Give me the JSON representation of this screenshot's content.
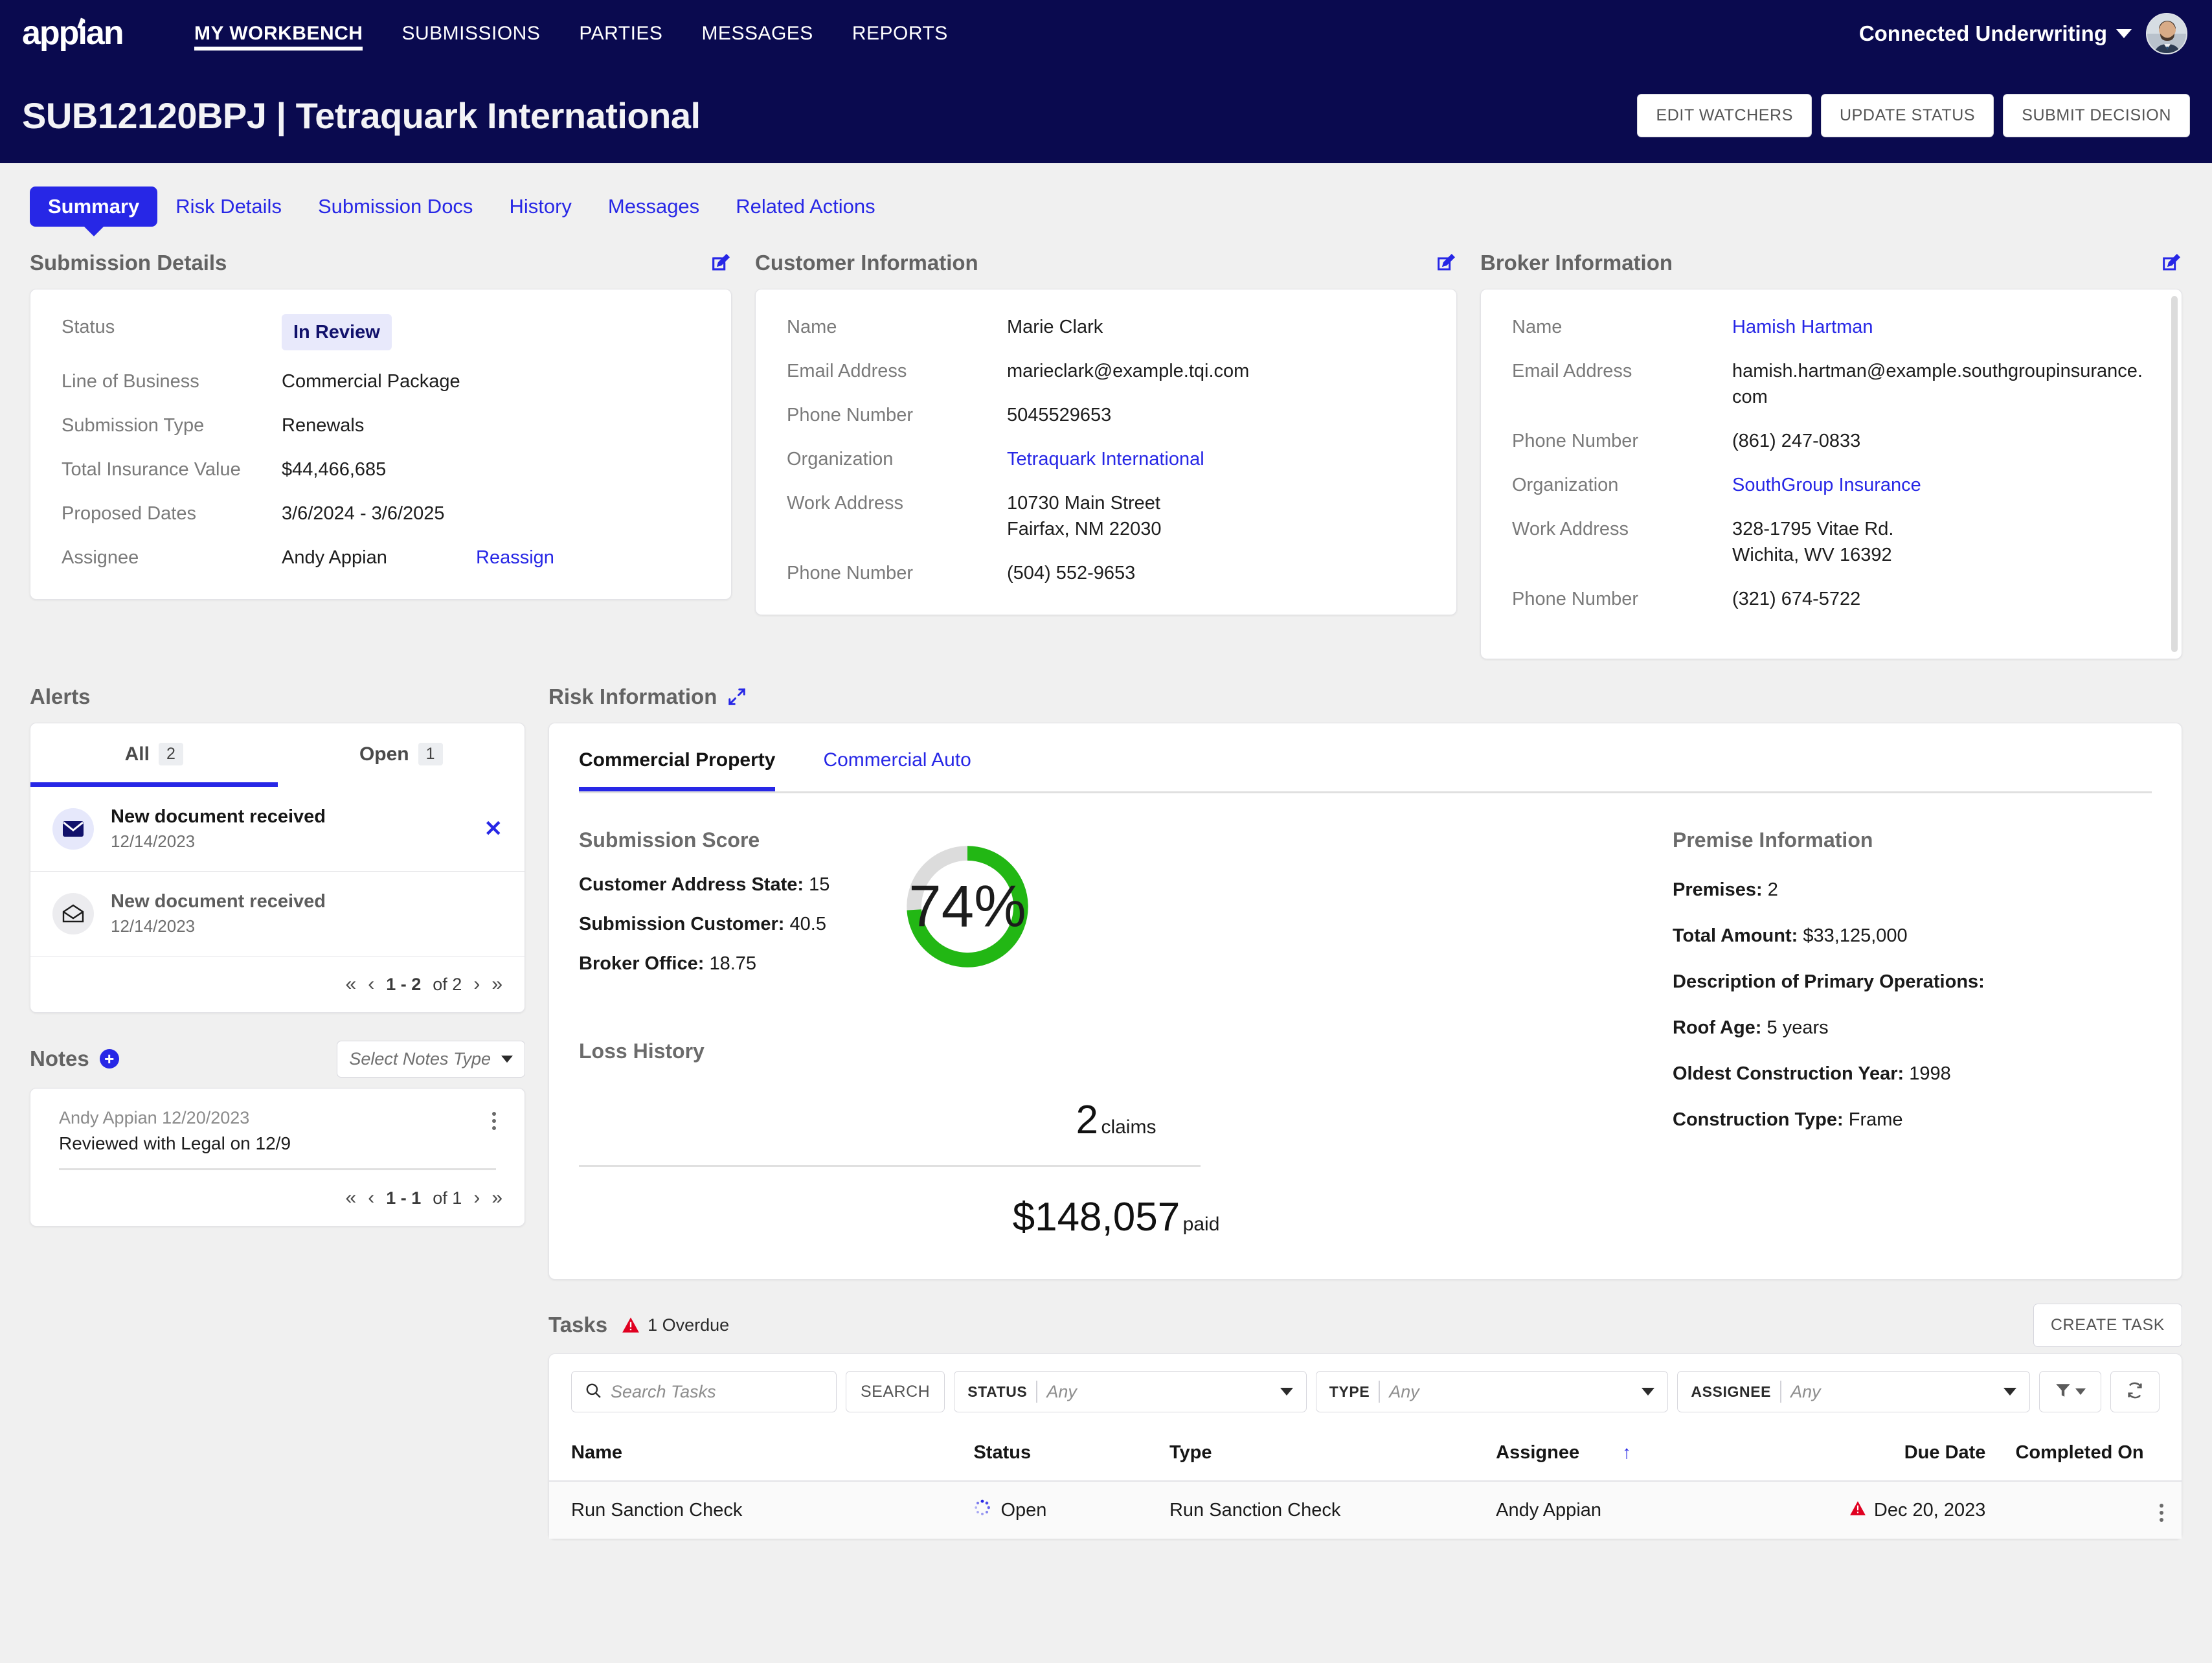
{
  "topnav": {
    "logo_alt": "appian",
    "items": [
      {
        "label": "MY WORKBENCH",
        "active": true
      },
      {
        "label": "SUBMISSIONS",
        "active": false
      },
      {
        "label": "PARTIES",
        "active": false
      },
      {
        "label": "MESSAGES",
        "active": false
      },
      {
        "label": "REPORTS",
        "active": false
      }
    ],
    "tenant": "Connected Underwriting"
  },
  "header": {
    "title": "SUB12120BPJ | Tetraquark International",
    "actions": [
      "EDIT WATCHERS",
      "UPDATE STATUS",
      "SUBMIT DECISION"
    ]
  },
  "tabs": [
    {
      "label": "Summary",
      "active": true
    },
    {
      "label": "Risk Details",
      "active": false
    },
    {
      "label": "Submission Docs",
      "active": false
    },
    {
      "label": "History",
      "active": false
    },
    {
      "label": "Messages",
      "active": false
    },
    {
      "label": "Related Actions",
      "active": false
    }
  ],
  "submission_details": {
    "title": "Submission Details",
    "status_label": "Status",
    "status_value": "In Review",
    "rows": [
      {
        "k": "Line of Business",
        "v": "Commercial Package"
      },
      {
        "k": "Submission Type",
        "v": "Renewals"
      },
      {
        "k": "Total Insurance Value",
        "v": "$44,466,685"
      },
      {
        "k": "Proposed Dates",
        "v": "3/6/2024 - 3/6/2025"
      }
    ],
    "assignee_label": "Assignee",
    "assignee_value": "Andy Appian",
    "reassign_label": "Reassign"
  },
  "customer_information": {
    "title": "Customer Information",
    "rows": [
      {
        "k": "Name",
        "v": "Marie Clark",
        "link": false
      },
      {
        "k": "Email Address",
        "v": "marieclark@example.tqi.com",
        "link": false
      },
      {
        "k": "Phone Number",
        "v": "5045529653",
        "link": false
      },
      {
        "k": "Organization",
        "v": "Tetraquark International",
        "link": true
      }
    ],
    "work_address_label": "Work Address",
    "work_address_line1": "10730 Main Street",
    "work_address_line2": "Fairfax, NM 22030",
    "phone_label": "Phone Number",
    "phone_value": "(504) 552-9653"
  },
  "broker_information": {
    "title": "Broker Information",
    "name_label": "Name",
    "name_value": "Hamish Hartman",
    "email_label": "Email Address",
    "email_value": "hamish.hartman@example.southgroupinsurance.com",
    "phone1_label": "Phone Number",
    "phone1_value": "(861) 247-0833",
    "org_label": "Organization",
    "org_value": "SouthGroup Insurance",
    "work_address_label": "Work Address",
    "work_address_line1": "328-1795 Vitae Rd.",
    "work_address_line2": "Wichita, WV 16392",
    "phone2_label": "Phone Number",
    "phone2_value": "(321) 674-5722"
  },
  "alerts": {
    "title": "Alerts",
    "tabs": [
      {
        "label": "All",
        "count": "2",
        "active": true
      },
      {
        "label": "Open",
        "count": "1",
        "active": false
      }
    ],
    "items": [
      {
        "title": "New document received",
        "date": "12/14/2023",
        "unread": true,
        "icon": "envelope-filled-icon"
      },
      {
        "title": "New document received",
        "date": "12/14/2023",
        "unread": false,
        "icon": "envelope-open-icon"
      }
    ],
    "pager": {
      "first": "«",
      "prev": "‹",
      "range": "1 - 2",
      "of": "of 2",
      "next": "›",
      "last": "»"
    }
  },
  "notes": {
    "title": "Notes",
    "select_placeholder": "Select Notes Type",
    "items": [
      {
        "author": "Andy Appian",
        "date": "12/20/2023",
        "text": "Reviewed with Legal on 12/9"
      }
    ],
    "pager": {
      "first": "«",
      "prev": "‹",
      "range": "1 - 1",
      "of": "of 1",
      "next": "›",
      "last": "»"
    }
  },
  "risk_information": {
    "title": "Risk Information",
    "tabs": [
      {
        "label": "Commercial Property",
        "active": true
      },
      {
        "label": "Commercial Auto",
        "active": false
      }
    ],
    "submission_score": {
      "heading": "Submission Score",
      "lines": [
        {
          "label": "Customer Address State",
          "value": "15"
        },
        {
          "label": "Submission Customer",
          "value": "40.5"
        },
        {
          "label": "Broker Office",
          "value": "18.75"
        }
      ],
      "percent_text": "74%"
    },
    "premise_information": {
      "heading": "Premise Information",
      "lines": [
        {
          "label": "Premises",
          "value": "2"
        },
        {
          "label": "Total Amount",
          "value": "$33,125,000"
        },
        {
          "label": "Description of Primary Operations",
          "value": ""
        },
        {
          "label": "Roof Age",
          "value": "5 years"
        },
        {
          "label": "Oldest Construction Year",
          "value": "1998"
        },
        {
          "label": "Construction Type",
          "value": "Frame"
        }
      ]
    },
    "loss_history": {
      "heading": "Loss History",
      "claims_number": "2",
      "claims_unit": "claims",
      "paid_amount": "$148,057",
      "paid_unit": "paid"
    }
  },
  "tasks": {
    "title": "Tasks",
    "overdue_text": "1 Overdue",
    "create_label": "CREATE TASK",
    "search_placeholder": "Search Tasks",
    "search_button": "SEARCH",
    "filters": [
      {
        "label": "STATUS",
        "value": "Any"
      },
      {
        "label": "TYPE",
        "value": "Any"
      },
      {
        "label": "ASSIGNEE",
        "value": "Any"
      }
    ],
    "columns": [
      "Name",
      "Status",
      "Type",
      "Assignee",
      "Due Date",
      "Completed On"
    ],
    "rows": [
      {
        "name": "Run Sanction Check",
        "status": "Open",
        "type": "Run Sanction Check",
        "assignee": "Andy Appian",
        "due_date": "Dec 20, 2023",
        "due_overdue": true,
        "completed_on": ""
      }
    ]
  },
  "chart_data": {
    "type": "pie",
    "title": "Submission Score",
    "categories": [
      "Score",
      "Remaining"
    ],
    "values": [
      74,
      26
    ],
    "unit": "%",
    "center_label": "74%",
    "colors": [
      "#22b714",
      "#dcdcdc"
    ]
  },
  "colors": {
    "brand_navy": "#0a0a4f",
    "accent_blue": "#2727e6",
    "page_bg": "#f0f0f0",
    "gauge_green": "#22b714",
    "gauge_track": "#dcdcdc",
    "overdue_red": "#e00020"
  }
}
